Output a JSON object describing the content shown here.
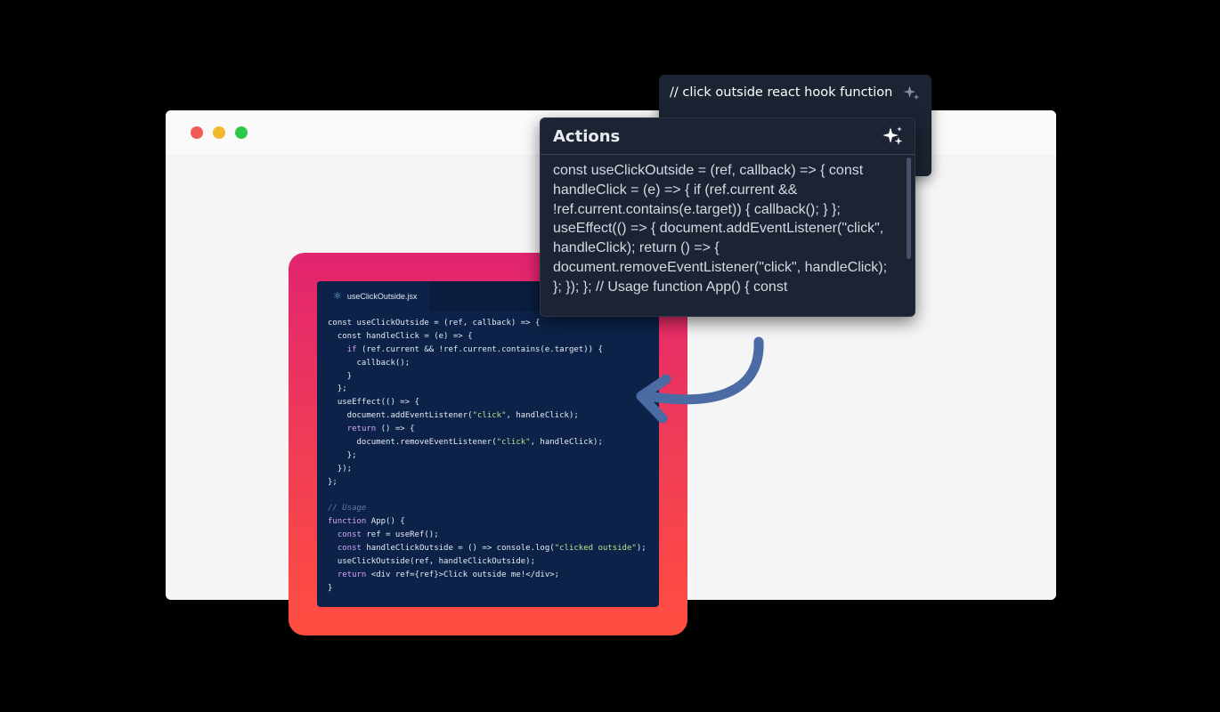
{
  "browser": {
    "controls": [
      "close",
      "minimize",
      "maximize"
    ]
  },
  "editor": {
    "tab_icon": "react-icon",
    "tab_label": "useClickOutside.jsx",
    "code_lines": [
      [
        [
          "const useClickOutside = (ref, callback) => {",
          "plain"
        ]
      ],
      [
        [
          "  const handleClick = (e) => {",
          "plain"
        ]
      ],
      [
        [
          "    ",
          "plain"
        ],
        [
          "if",
          "kw"
        ],
        [
          " (ref.current && !ref.current.contains(e.target)) {",
          "plain"
        ]
      ],
      [
        [
          "      callback();",
          "plain"
        ]
      ],
      [
        [
          "    }",
          "plain"
        ]
      ],
      [
        [
          "  };",
          "plain"
        ]
      ],
      [
        [
          "  useEffect(() => {",
          "plain"
        ]
      ],
      [
        [
          "    document.addEventListener(",
          "plain"
        ],
        [
          "\"click\"",
          "str"
        ],
        [
          ", handleClick);",
          "plain"
        ]
      ],
      [
        [
          "    ",
          "plain"
        ],
        [
          "return",
          "kw"
        ],
        [
          " () => {",
          "plain"
        ]
      ],
      [
        [
          "      document.removeEventListener(",
          "plain"
        ],
        [
          "\"click\"",
          "str"
        ],
        [
          ", handleClick);",
          "plain"
        ]
      ],
      [
        [
          "    };",
          "plain"
        ]
      ],
      [
        [
          "  });",
          "plain"
        ]
      ],
      [
        [
          "};",
          "plain"
        ]
      ],
      [
        [
          "",
          "plain"
        ]
      ],
      [
        [
          "// Usage",
          "cm"
        ]
      ],
      [
        [
          "function",
          "kw"
        ],
        [
          " App() {",
          "plain"
        ]
      ],
      [
        [
          "  ",
          "plain"
        ],
        [
          "const",
          "kw"
        ],
        [
          " ref = useRef();",
          "plain"
        ]
      ],
      [
        [
          "  ",
          "plain"
        ],
        [
          "const",
          "kw"
        ],
        [
          " handleClickOutside = () => console.log(",
          "plain"
        ],
        [
          "\"clicked outside\"",
          "str"
        ],
        [
          ");",
          "plain"
        ]
      ],
      [
        [
          "  useClickOutside(ref, handleClickOutside);",
          "plain"
        ]
      ],
      [
        [
          "  ",
          "plain"
        ],
        [
          "return",
          "kw"
        ],
        [
          " <div ref={ref}>Click outside me!</div>;",
          "plain"
        ]
      ],
      [
        [
          "}",
          "plain"
        ]
      ]
    ]
  },
  "prompt_panel": {
    "text": "// click outside react hook function",
    "icon": "sparkle-icon"
  },
  "actions_panel": {
    "title": "Actions",
    "icon": "sparkle-icon",
    "body": "const useClickOutside = (ref, callback) => { const handleClick = (e) => { if (ref.current && !ref.current.contains(e.target)) { callback(); } }; useEffect(() => { document.addEventListener(\"click\", handleClick); return () => { document.removeEventListener(\"click\", handleClick); }; }); }; // Usage function App() { const"
  },
  "colors": {
    "background": "#000000",
    "browser": "#f5f5f6",
    "gradient_top": "#e22470",
    "gradient_bottom": "#ff4e40",
    "editor_bg": "#0c2248",
    "panel_bg": "#1c2433",
    "arrow": "#4a6ba4"
  }
}
